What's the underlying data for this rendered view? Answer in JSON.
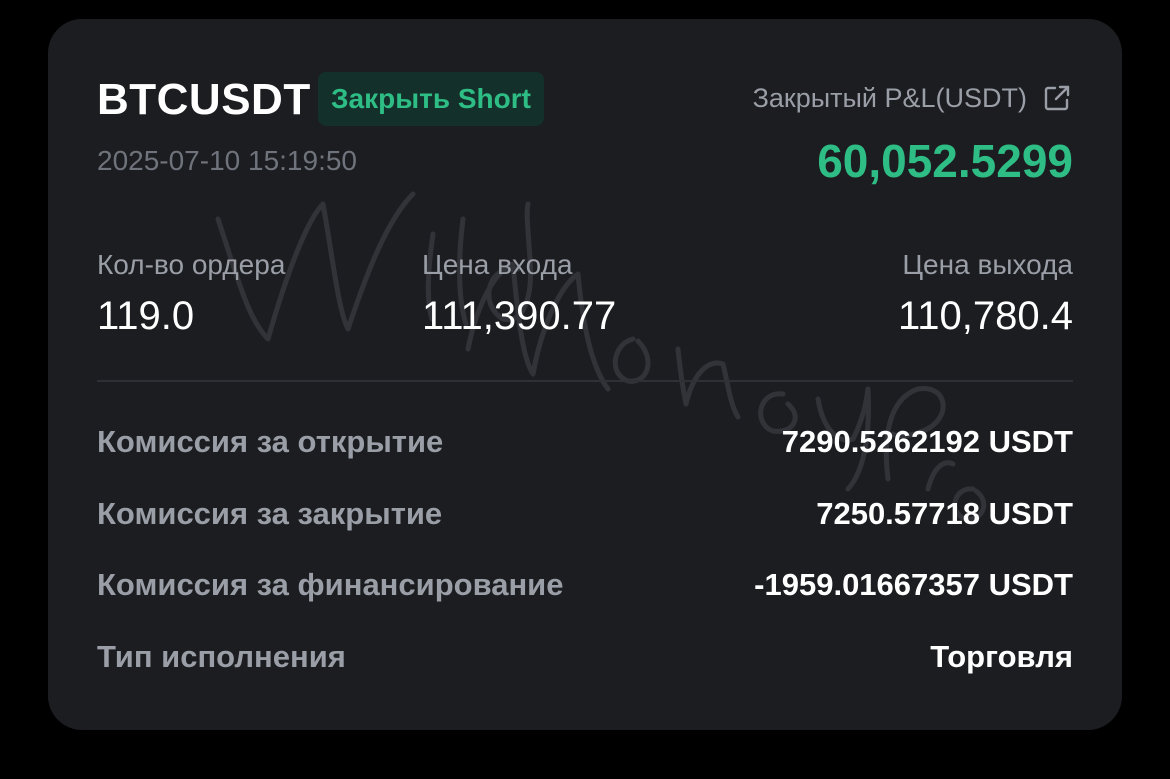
{
  "trade": {
    "symbol": "BTCUSDT",
    "side_badge": "Закрыть Short",
    "timestamp": "2025-07-10 15:19:50",
    "closed_pnl_label": "Закрытый P&L(USDT)",
    "closed_pnl_value": "60,052.5299",
    "share_icon": "external-link-icon"
  },
  "stats": {
    "order_qty_label": "Кол-во ордера",
    "order_qty_value": "119.0",
    "entry_price_label": "Цена входа",
    "entry_price_value": "111,390.77",
    "exit_price_label": "Цена выхода",
    "exit_price_value": "110,780.4"
  },
  "details": [
    {
      "label": "Комиссия за открытие",
      "value": "7290.5262192 USDT"
    },
    {
      "label": "Комиссия за закрытие",
      "value": "7250.57718 USDT"
    },
    {
      "label": "Комиссия за финансирование",
      "value": "-1959.01667357 USDT"
    },
    {
      "label": "Тип исполнения",
      "value": "Торговля"
    }
  ],
  "colors": {
    "background": "#000000",
    "card": "#1c1d21",
    "accent_green": "#2ebd85",
    "badge_bg": "#14302a",
    "muted_text": "#9a9ea6",
    "primary_text": "#ffffff"
  }
}
